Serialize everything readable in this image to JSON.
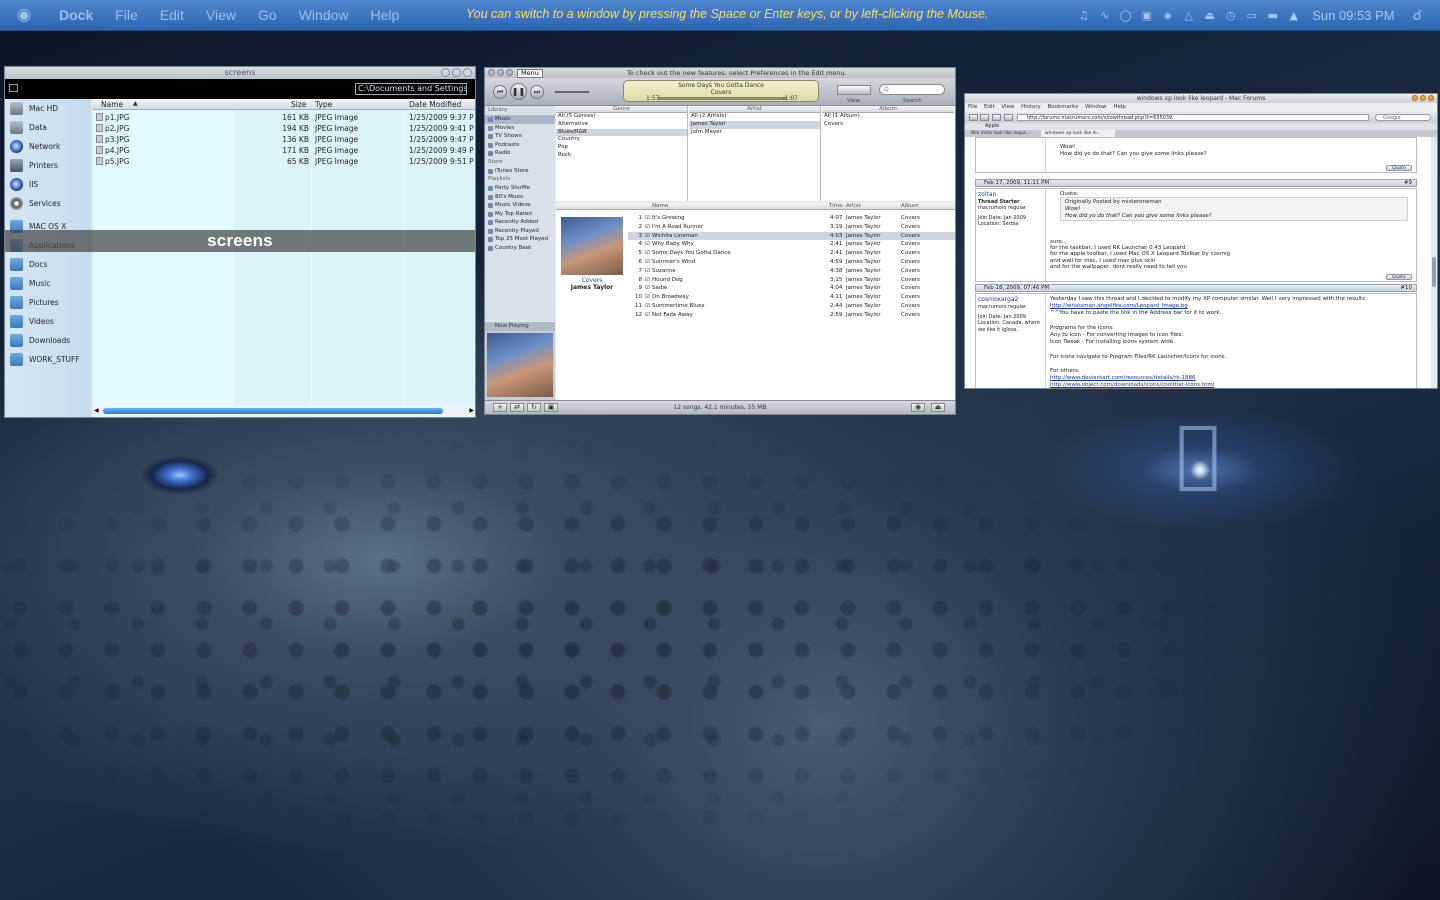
{
  "menubar": {
    "items": [
      "Dock",
      "File",
      "Edit",
      "View",
      "Go",
      "Window",
      "Help"
    ],
    "hint": "You can switch to a window by pressing the Space or Enter keys, or by left-clicking the Mouse.",
    "clock": "Sun 09:53 PM",
    "tray_icons": [
      "music-icon",
      "wifi-icon",
      "sync-icon",
      "flag-icon",
      "chat-icon",
      "bluetooth-icon",
      "eject-icon",
      "timer-icon",
      "display-icon",
      "battery-icon",
      "volume-icon"
    ]
  },
  "finder": {
    "title": "screens",
    "path": "C:\\Documents and Settings\\",
    "sidebar": [
      {
        "label": "Mac HD",
        "icon": "harddisk-icon"
      },
      {
        "label": "Data",
        "icon": "disk-icon"
      },
      {
        "label": "Network",
        "icon": "network-icon"
      },
      {
        "label": "Printers",
        "icon": "printer-icon"
      },
      {
        "label": "IIS",
        "icon": "iis-icon"
      },
      {
        "label": "Services",
        "icon": "gear-icon"
      },
      {
        "label": "MAC OS X",
        "icon": "folder-icon"
      },
      {
        "label": "Applications",
        "icon": "folder-icon"
      },
      {
        "label": "Docs",
        "icon": "folder-icon"
      },
      {
        "label": "Music",
        "icon": "folder-icon"
      },
      {
        "label": "Pictures",
        "icon": "folder-icon"
      },
      {
        "label": "Videos",
        "icon": "folder-icon"
      },
      {
        "label": "Downloads",
        "icon": "folder-icon"
      },
      {
        "label": "WORK_STUFF",
        "icon": "folder-icon"
      }
    ],
    "columns": {
      "name": "Name",
      "size": "Size",
      "type": "Type",
      "date": "Date Modified"
    },
    "files": [
      {
        "name": "p1.JPG",
        "size": "161 KB",
        "type": "JPEG Image",
        "date": "1/25/2009 9:37 P"
      },
      {
        "name": "p2.JPG",
        "size": "194 KB",
        "type": "JPEG Image",
        "date": "1/25/2009 9:41 P"
      },
      {
        "name": "p3.JPG",
        "size": "136 KB",
        "type": "JPEG Image",
        "date": "1/25/2009 9:47 P"
      },
      {
        "name": "p4.JPG",
        "size": "171 KB",
        "type": "JPEG Image",
        "date": "1/25/2009 9:49 P"
      },
      {
        "name": "p5.JPG",
        "size": "65 KB",
        "type": "JPEG Image",
        "date": "1/25/2009 9:51 P"
      }
    ],
    "overlay_label": "screens"
  },
  "itunes": {
    "menu_label": "Menu",
    "note": "To check out the new features, select Preferences in the Edit menu.",
    "lcd": {
      "line1": "Some Days You Gotta Dance",
      "line2": "Covers",
      "elapsed": "1:57",
      "remaining": "-1:07"
    },
    "view_label": "View",
    "search_label": "Search",
    "search_placeholder": "Q",
    "library_header": "Library",
    "library": [
      "Music",
      "Movies",
      "TV Shows",
      "Podcasts",
      "Radio"
    ],
    "store_header": "Store",
    "store": [
      "iTunes Store"
    ],
    "playlists_header": "Playlists",
    "playlists": [
      "Party Shuffle",
      "80's Music",
      "Music Videos",
      "My Top Rated",
      "Recently Added",
      "Recently Played",
      "Top 25 Most Played",
      "Country Beat"
    ],
    "nowplaying_header": "Now Playing",
    "browser": {
      "genre_header": "Genre",
      "genres": [
        "All (5 Genres)",
        "Alternative",
        "Blues/R&B",
        "Country",
        "Pop",
        "Rock"
      ],
      "artist_header": "Artist",
      "artists": [
        "All (2 Artists)",
        "James Taylor",
        "John Mayer"
      ],
      "album_header": "Album",
      "albums": [
        "All (1 Album)",
        "Covers"
      ]
    },
    "track_headers": {
      "name": "Name",
      "time": "Time",
      "artist": "Artist",
      "album": "Album"
    },
    "album_title": "Covers",
    "album_artist": "James Taylor",
    "tracks": [
      {
        "num": "1",
        "name": "It's Growing",
        "time": "4:07",
        "artist": "James Taylor",
        "album": "Covers"
      },
      {
        "num": "2",
        "name": "I'm A Road Runner",
        "time": "3:19",
        "artist": "James Taylor",
        "album": "Covers"
      },
      {
        "num": "3",
        "name": "Wichita Lineman",
        "time": "4:03",
        "artist": "James Taylor",
        "album": "Covers"
      },
      {
        "num": "4",
        "name": "Why Baby Why",
        "time": "2:41",
        "artist": "James Taylor",
        "album": "Covers"
      },
      {
        "num": "5",
        "name": "Some Days You Gotta Dance",
        "time": "2:41",
        "artist": "James Taylor",
        "album": "Covers"
      },
      {
        "num": "6",
        "name": "Summer's Wind",
        "time": "4:59",
        "artist": "James Taylor",
        "album": "Covers"
      },
      {
        "num": "7",
        "name": "Suzanne",
        "time": "4:38",
        "artist": "James Taylor",
        "album": "Covers"
      },
      {
        "num": "8",
        "name": "Hound Dog",
        "time": "3:15",
        "artist": "James Taylor",
        "album": "Covers"
      },
      {
        "num": "9",
        "name": "Sadie",
        "time": "4:04",
        "artist": "James Taylor",
        "album": "Covers"
      },
      {
        "num": "10",
        "name": "On Broadway",
        "time": "4:11",
        "artist": "James Taylor",
        "album": "Covers"
      },
      {
        "num": "11",
        "name": "Summertime Blues",
        "time": "2:44",
        "artist": "James Taylor",
        "album": "Covers"
      },
      {
        "num": "12",
        "name": "Not Fade Away",
        "time": "2:59",
        "artist": "James Taylor",
        "album": "Covers"
      }
    ],
    "status": "12 songs, 42.1 minutes, 55 MB"
  },
  "browser": {
    "title": "windows xp look like leopard - Mac Forums",
    "menus": "File Edit View History Bookmarks Window Help",
    "url": "http://forums.macrumors.com/showthread.php?t=635039",
    "search_placeholder": "Google",
    "bookmark": "Apple",
    "tabs": [
      "Win Vista look like leopa...",
      "windows xp look like le..."
    ],
    "posts": [
      {
        "lines": [
          "Wow!",
          "How did yo do that? Can you give some links please?"
        ]
      },
      {
        "date": "Feb 17, 2009, 11:11 PM",
        "num": "#9",
        "user": "zoltan",
        "rank": "Thread Starter",
        "rank2": "macrumors regular",
        "joined": "Join Date: Jan 2009",
        "location": "Location: Serbia",
        "quote_by": "Originally Posted by misteroneman",
        "quote_lines": [
          "Wow!",
          "How did yo do that? Can you give some links please?"
        ],
        "lines": [
          "sure...",
          "for the taskbar, I used RK Launcher 0.43 Leopard",
          "for the apple toolbar, I used Mac OS X Leopard Toolbar by cosmig",
          "and wall for mac, I used mac plus skin",
          "and for the wallpaper, dont really need to tell you"
        ]
      },
      {
        "date": "Feb 18, 2009, 07:46 PM",
        "num": "#10",
        "user": "cosmoxarga2",
        "rank": "macrumors regular",
        "joined": "Join Date: Jan 2009",
        "location": "Location: Canada, where we like it igloos.",
        "lines": [
          "Yesterday I saw this thread and I decided to modify my XP computer similar. Well I very impressed with the results.",
          "http://whatsman.angelfire.com/Leopard_Image.bg",
          "^^You have to paste the link in the Address bar for it to work.",
          "",
          "Programs for the icons:",
          "Any to Icon - For converting images to icon files.",
          "Icon Tweak - For installing icons system wide.",
          "",
          "For icons navigate to Program Files/RK Launcher/Icons for icons.",
          "",
          "For others:",
          "http://www.deviantart.com/resources/details/rk-1886",
          "http://www.object.com/downloads/icons/coolthat-icons.html"
        ]
      }
    ],
    "quote_btn": "Quote"
  }
}
